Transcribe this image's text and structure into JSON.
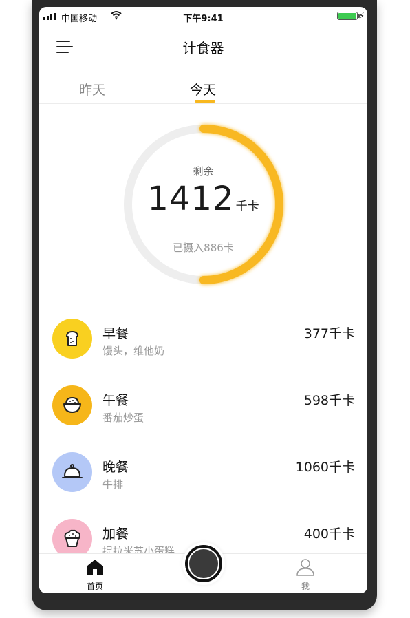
{
  "status_bar": {
    "carrier": "中国移动",
    "time": "下午9:41"
  },
  "nav": {
    "title": "计食器",
    "menu_icon": "menu-icon"
  },
  "tabs": [
    {
      "label": "昨天",
      "active": false
    },
    {
      "label": "今天",
      "active": true
    }
  ],
  "summary": {
    "remaining_label": "剩余",
    "remaining_value": "1412",
    "remaining_unit": "千卡",
    "intake_text": "已摄入886卡",
    "progress_fraction": 0.5,
    "ring_color": "#f8b820",
    "track_color": "#eeeeee"
  },
  "meals": [
    {
      "name": "早餐",
      "desc": "馒头，维他奶",
      "kcal": "377千卡",
      "icon": "bread-icon",
      "color": "#f9d020"
    },
    {
      "name": "午餐",
      "desc": "番茄炒蛋",
      "kcal": "598千卡",
      "icon": "bowl-icon",
      "color": "#f6b619"
    },
    {
      "name": "晚餐",
      "desc": "牛排",
      "kcal": "1060千卡",
      "icon": "cloche-icon",
      "color": "#b4c8f7"
    },
    {
      "name": "加餐",
      "desc": "提拉米苏小蛋糕",
      "kcal": "400千卡",
      "icon": "cupcake-icon",
      "color": "#f7b5c8"
    }
  ],
  "tabbar": {
    "home_label": "首页",
    "me_label": "我"
  }
}
